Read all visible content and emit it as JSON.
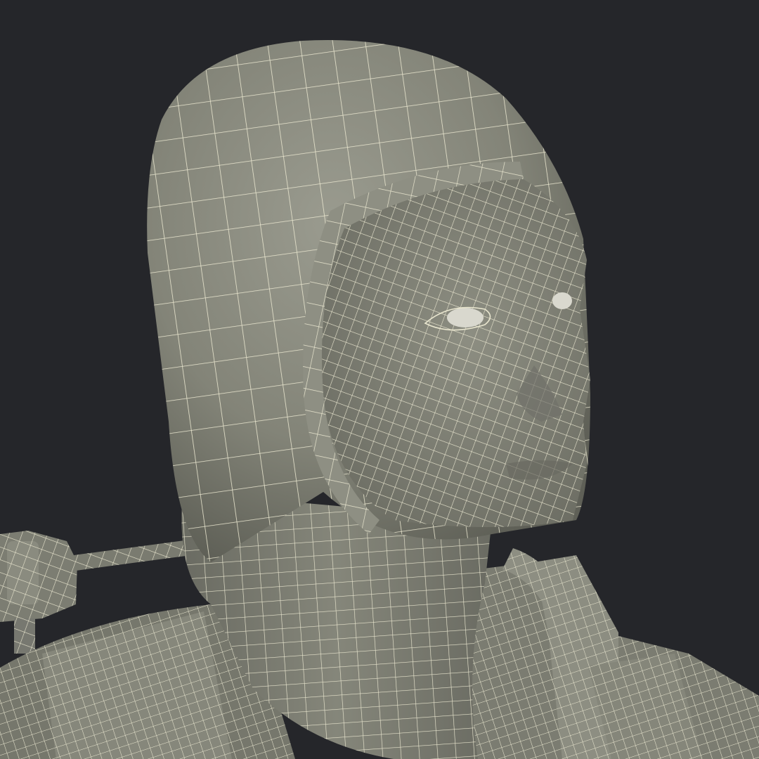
{
  "scene": {
    "subject": "wireframe-head-bust",
    "colors": {
      "background": "#25262a",
      "surface": "#838478",
      "surface_shadow": "#5f6057",
      "surface_light": "#9a9b8f",
      "wire": "#e9e6cf",
      "eye": "#d9d8ce"
    }
  }
}
